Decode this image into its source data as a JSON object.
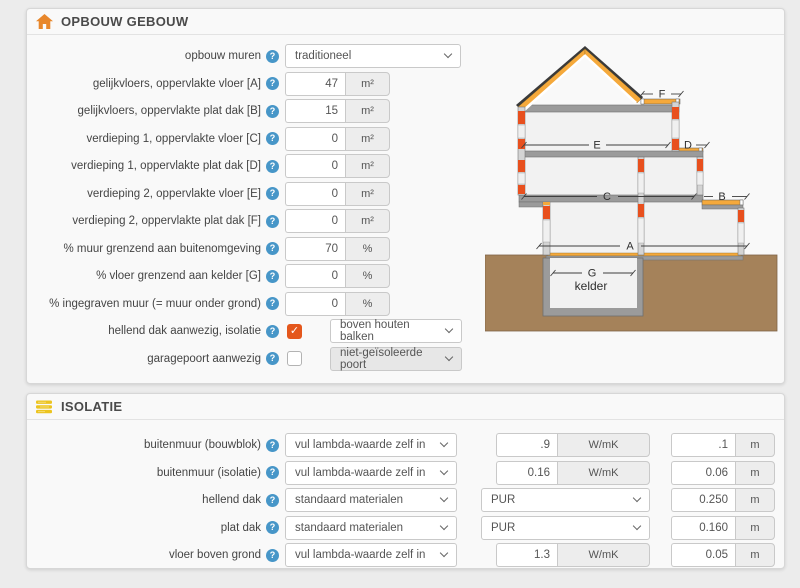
{
  "opbouw": {
    "title": "OPBOUW GEBOUW",
    "rows": [
      {
        "label": "opbouw muren",
        "value": "traditioneel"
      },
      {
        "label": "gelijkvloers, oppervlakte vloer [A]",
        "value": "47",
        "unit": "m²"
      },
      {
        "label": "gelijkvloers, oppervlakte plat dak [B]",
        "value": "15",
        "unit": "m²"
      },
      {
        "label": "verdieping 1, oppervlakte vloer [C]",
        "value": "0",
        "unit": "m²"
      },
      {
        "label": "verdieping 1, oppervlakte plat dak [D]",
        "value": "0",
        "unit": "m²"
      },
      {
        "label": "verdieping 2, oppervlakte vloer [E]",
        "value": "0",
        "unit": "m²"
      },
      {
        "label": "verdieping 2, oppervlakte plat dak [F]",
        "value": "0",
        "unit": "m²"
      },
      {
        "label": "% muur grenzend aan buitenomgeving",
        "value": "70",
        "unit": "%"
      },
      {
        "label": "% vloer grenzend aan kelder [G]",
        "value": "0",
        "unit": "%"
      },
      {
        "label": "% ingegraven muur (= muur onder grond)",
        "value": "0",
        "unit": "%"
      }
    ],
    "check_rows": [
      {
        "label": "hellend dak aanwezig, isolatie",
        "checked": true,
        "value": "boven houten balken"
      },
      {
        "label": "garagepoort aanwezig",
        "checked": false,
        "value": "niet-geïsoleerde poort"
      }
    ],
    "diagram": {
      "a": "A",
      "b": "B",
      "c": "C",
      "d": "D",
      "e": "E",
      "f": "F",
      "g": "G",
      "kelder": "kelder"
    }
  },
  "isolatie": {
    "title": "ISOLATIE",
    "rows": [
      {
        "label": "buitenmuur (bouwblok)",
        "method": "vul lambda-waarde zelf in",
        "lambda": ".9",
        "lambda_unit": "W/mK",
        "thickness": ".1",
        "thickness_unit": "m"
      },
      {
        "label": "buitenmuur (isolatie)",
        "method": "vul lambda-waarde zelf in",
        "lambda": "0.16",
        "lambda_unit": "W/mK",
        "thickness": "0.06",
        "thickness_unit": "m"
      },
      {
        "label": "hellend dak",
        "method": "standaard materialen",
        "material": "PUR",
        "thickness": "0.250",
        "thickness_unit": "m"
      },
      {
        "label": "plat dak",
        "method": "standaard materialen",
        "material": "PUR",
        "thickness": "0.160",
        "thickness_unit": "m"
      },
      {
        "label": "vloer boven grond",
        "method": "vul lambda-waarde zelf in",
        "lambda": "1.3",
        "lambda_unit": "W/mK",
        "thickness": "0.05",
        "thickness_unit": "m"
      }
    ]
  },
  "colors": {
    "accent_orange": "#e4571c",
    "icon_orange": "#e8872b",
    "icon_yellow": "#ecc41f",
    "help_blue": "#4796c8",
    "roof_orange": "#f5a93b",
    "wall_red": "#e8501e",
    "ground_brown": "#a5825a"
  }
}
